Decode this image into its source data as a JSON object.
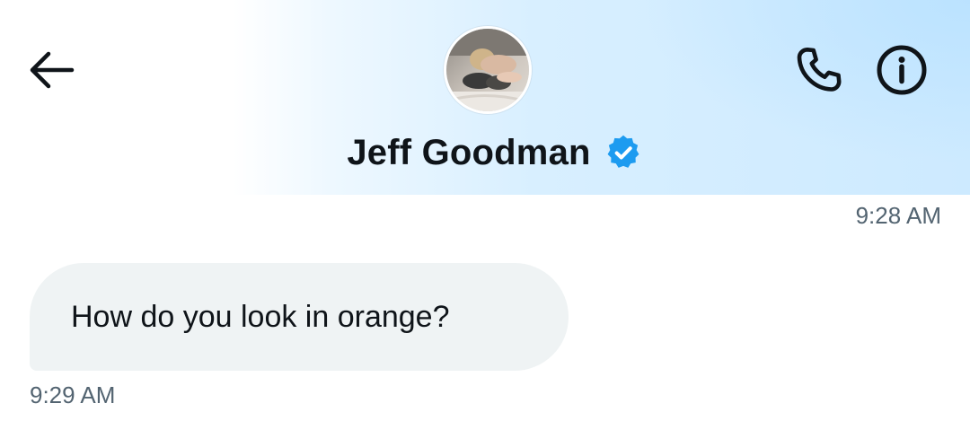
{
  "header": {
    "contact_name": "Jeff Goodman",
    "verified": true,
    "icons": {
      "back": "arrow-left-icon",
      "call": "phone-icon",
      "info": "info-icon",
      "verified": "verified-badge-icon"
    }
  },
  "messages": [
    {
      "timestamp": "9:28 AM"
    },
    {
      "text": "How do you look in orange?",
      "timestamp": "9:29 AM"
    }
  ],
  "colors": {
    "verified_blue": "#1d9bf0",
    "bubble_bg": "#eff3f4",
    "text_primary": "#0f1419",
    "text_secondary": "#536471",
    "header_tint": "#cdeaff"
  }
}
